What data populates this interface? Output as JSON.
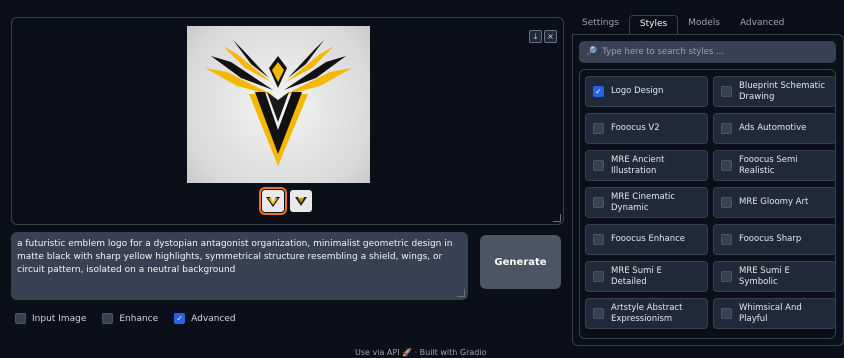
{
  "gallery": {
    "download_label": "⤓",
    "close_label": "×"
  },
  "prompt": {
    "text": "a futuristic emblem logo for a dystopian antagonist organization, minimalist geometric design in matte black with sharp yellow highlights, symmetrical structure resembling a shield, wings, or circuit pattern, isolated on a neutral background"
  },
  "generate_label": "Generate",
  "options": [
    {
      "label": "Input Image",
      "checked": false
    },
    {
      "label": "Enhance",
      "checked": false
    },
    {
      "label": "Advanced",
      "checked": true
    }
  ],
  "footer": "Use via API 🚀 · Built with Gradio",
  "tabs": [
    "Settings",
    "Styles",
    "Models",
    "Advanced"
  ],
  "active_tab": "Styles",
  "search": {
    "placeholder": "Type here to search styles ..."
  },
  "styles": [
    {
      "label": "Logo Design",
      "checked": true
    },
    {
      "label": "Blueprint Schematic Drawing",
      "checked": false
    },
    {
      "label": "Fooocus V2",
      "checked": false
    },
    {
      "label": "Ads Automotive",
      "checked": false
    },
    {
      "label": "MRE Ancient Illustration",
      "checked": false
    },
    {
      "label": "Fooocus Semi Realistic",
      "checked": false
    },
    {
      "label": "MRE Cinematic Dynamic",
      "checked": false
    },
    {
      "label": "MRE Gloomy Art",
      "checked": false
    },
    {
      "label": "Fooocus Enhance",
      "checked": false
    },
    {
      "label": "Fooocus Sharp",
      "checked": false
    },
    {
      "label": "MRE Sumi E Detailed",
      "checked": false
    },
    {
      "label": "MRE Sumi E Symbolic",
      "checked": false
    },
    {
      "label": "Artstyle Abstract Expressionism",
      "checked": false
    },
    {
      "label": "Whimsical And Playful",
      "checked": false
    }
  ],
  "colors": {
    "accent": "#2563eb",
    "selected_thumb": "#f97316",
    "logo_yellow": "#f5b800"
  }
}
